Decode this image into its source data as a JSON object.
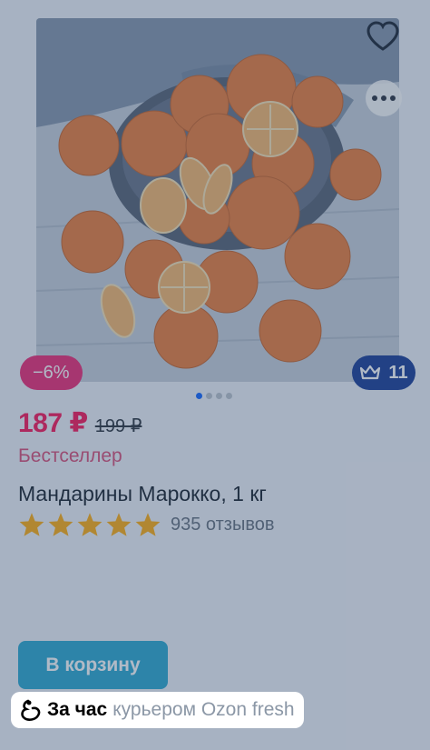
{
  "product": {
    "discount": "−6%",
    "crown_count": "11",
    "price": "187 ₽",
    "old_price": "199 ₽",
    "badge": "Бестселлер",
    "title": "Мандарины Марокко, 1 кг",
    "rating": 5,
    "reviews": "935 отзывов",
    "cart_label": "В корзину",
    "delivery_bold": "За час",
    "delivery_rest": "курьером Ozon fresh",
    "pager_total": 4,
    "pager_active": 0
  },
  "colors": {
    "accent": "#005bff",
    "price": "#f8064d",
    "discount_bg": "#ec1c6b",
    "crown_bg": "#0a2f8f",
    "cart_bg": "#1ca3ce",
    "star": "#ffa800"
  },
  "icons": {
    "favorite": "heart-icon",
    "more": "more-dots-icon",
    "crown": "crown-icon",
    "star": "star-icon",
    "delivery": "ozon-fresh-icon"
  }
}
